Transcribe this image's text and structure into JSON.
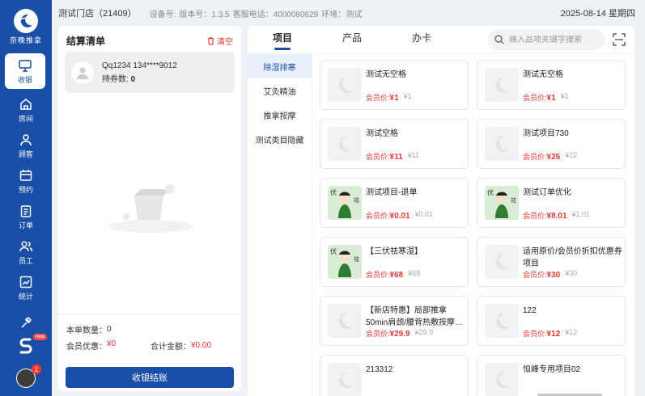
{
  "sidebar": {
    "logo_text": "奈晚推拿",
    "items": [
      {
        "label": "收银",
        "icon": "monitor-icon",
        "active": true
      },
      {
        "label": "房间",
        "icon": "home-icon"
      },
      {
        "label": "顾客",
        "icon": "user-icon"
      },
      {
        "label": "预约",
        "icon": "calendar-icon"
      },
      {
        "label": "订单",
        "icon": "order-icon"
      },
      {
        "label": "员工",
        "icon": "staff-icon"
      },
      {
        "label": "统计",
        "icon": "chart-icon"
      },
      {
        "label": "",
        "icon": "tool-icon"
      }
    ],
    "new_badge": "new",
    "notification_count": "1"
  },
  "topbar": {
    "store": "测试门店（21409）",
    "device": "设备号:",
    "version": "版本号：1.3.5",
    "phone": "客服电话：4000080629",
    "env": "环境：测试",
    "date": "2025-08-14 星期四"
  },
  "checkout": {
    "title": "结算清单",
    "clear": "清空",
    "member_name": "Qq1234 134****9012",
    "coupon_label": "持券数:",
    "coupon_count": "0",
    "qty_label": "本单数量：",
    "qty": "0",
    "discount_label": "会员优惠：",
    "discount": "¥0",
    "total_label": "合计金额：",
    "total": "¥0.00",
    "pay_button": "收银结账"
  },
  "catalog": {
    "tabs": [
      "项目",
      "产品",
      "办卡"
    ],
    "search_placeholder": "输入品项关键字搜索",
    "categories": [
      "除湿排寒",
      "艾灸精油",
      "推拿按摩",
      "测试类目隐藏"
    ],
    "price_label": "会员价:",
    "products": [
      {
        "name": "测试无空格",
        "member_price": "¥1",
        "original": "¥1",
        "thumb": "placeholder"
      },
      {
        "name": "测试无空格",
        "member_price": "¥1",
        "original": "¥1",
        "thumb": "placeholder"
      },
      {
        "name": "测试空格",
        "member_price": "¥11",
        "original": "¥11",
        "thumb": "placeholder"
      },
      {
        "name": "测试项目730",
        "member_price": "¥25",
        "original": "¥22",
        "thumb": "placeholder"
      },
      {
        "name": "测试项目-退单",
        "member_price": "¥0.01",
        "original": "¥0.01",
        "thumb": "illustration"
      },
      {
        "name": "测试订单优化",
        "member_price": "¥8.01",
        "original": "¥1.01",
        "thumb": "illustration"
      },
      {
        "name": "【三伏祛寒湿】",
        "member_price": "¥68",
        "original": "¥68",
        "thumb": "illustration"
      },
      {
        "name": "适用原价/会员价折扣优惠券项目",
        "member_price": "¥30",
        "original": "¥30",
        "thumb": "placeholder"
      },
      {
        "name": "【新店特惠】局部推拿50min肩颈/腰背热敷按摩…",
        "member_price": "¥29.9",
        "original": "¥29.9",
        "thumb": "placeholder"
      },
      {
        "name": "122",
        "member_price": "¥12",
        "original": "¥12",
        "thumb": "placeholder"
      },
      {
        "name": "213312",
        "member_price": "",
        "original": "",
        "thumb": "placeholder"
      },
      {
        "name": "恒峰专用项目02",
        "member_price": "",
        "original": "",
        "thumb": "placeholder"
      }
    ]
  },
  "colors": {
    "primary": "#1a4fa8",
    "price": "#e53935",
    "bg": "#eef1f6"
  }
}
